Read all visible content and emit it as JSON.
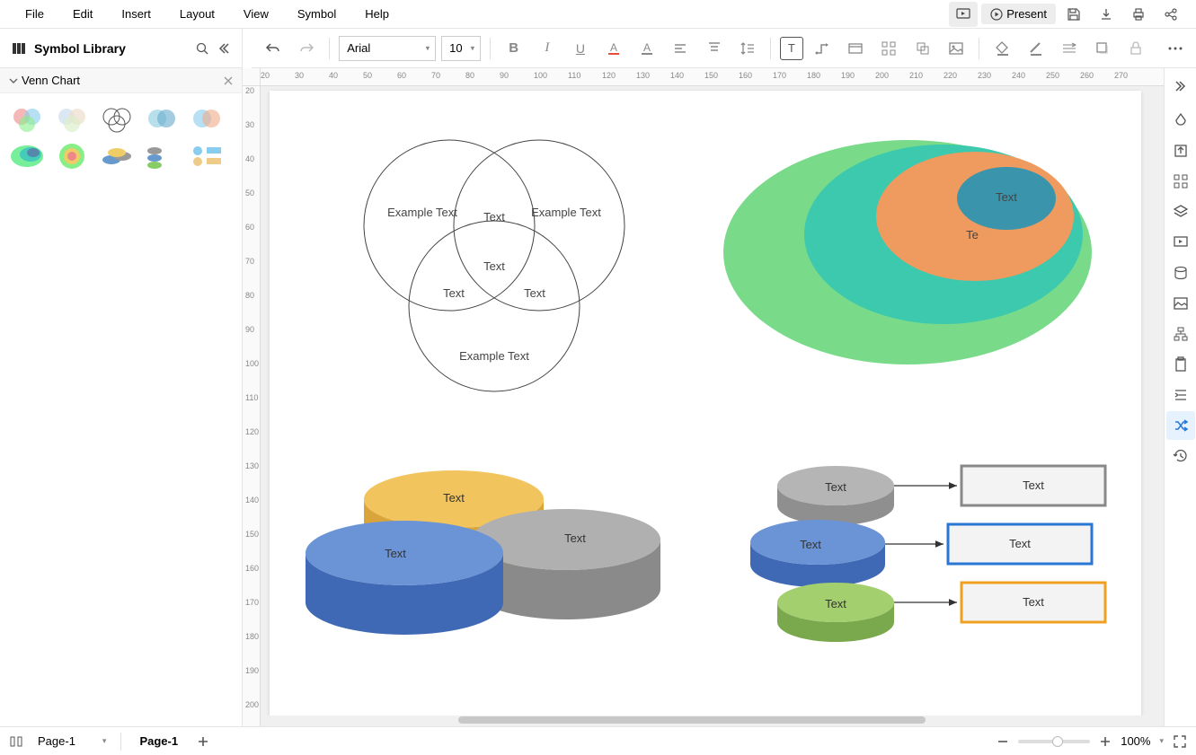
{
  "menu": {
    "file": "File",
    "edit": "Edit",
    "insert": "Insert",
    "layout": "Layout",
    "view": "View",
    "symbol": "Symbol",
    "help": "Help",
    "present": "Present"
  },
  "toolbar": {
    "font": "Arial",
    "size": "10"
  },
  "sidebar": {
    "title": "Symbol Library",
    "section": "Venn Chart"
  },
  "canvas": {
    "venn": {
      "a": "Example Text",
      "b": "Example Text",
      "c": "Example Text",
      "ab": "Text",
      "ac": "Text",
      "bc": "Text",
      "abc": "Text"
    },
    "stack": {
      "inner": "Text",
      "t2": "Te"
    },
    "cyl": {
      "a": "Text",
      "b": "Text",
      "c": "Text"
    },
    "list": {
      "c1": "Text",
      "c2": "Text",
      "c3": "Text",
      "b1": "Text",
      "b2": "Text",
      "b3": "Text"
    }
  },
  "ruler_h": [
    "20",
    "30",
    "40",
    "50",
    "60",
    "70",
    "80",
    "90",
    "100",
    "110",
    "120",
    "130",
    "140",
    "150",
    "160",
    "170",
    "180",
    "190",
    "200",
    "210",
    "220",
    "230",
    "240",
    "250",
    "260",
    "270"
  ],
  "ruler_v": [
    "20",
    "30",
    "40",
    "50",
    "60",
    "70",
    "80",
    "90",
    "100",
    "110",
    "120",
    "130",
    "140",
    "150",
    "160",
    "170",
    "180",
    "190",
    "200"
  ],
  "bottom": {
    "page_sel": "Page-1",
    "page_tab": "Page-1",
    "zoom": "100%"
  }
}
